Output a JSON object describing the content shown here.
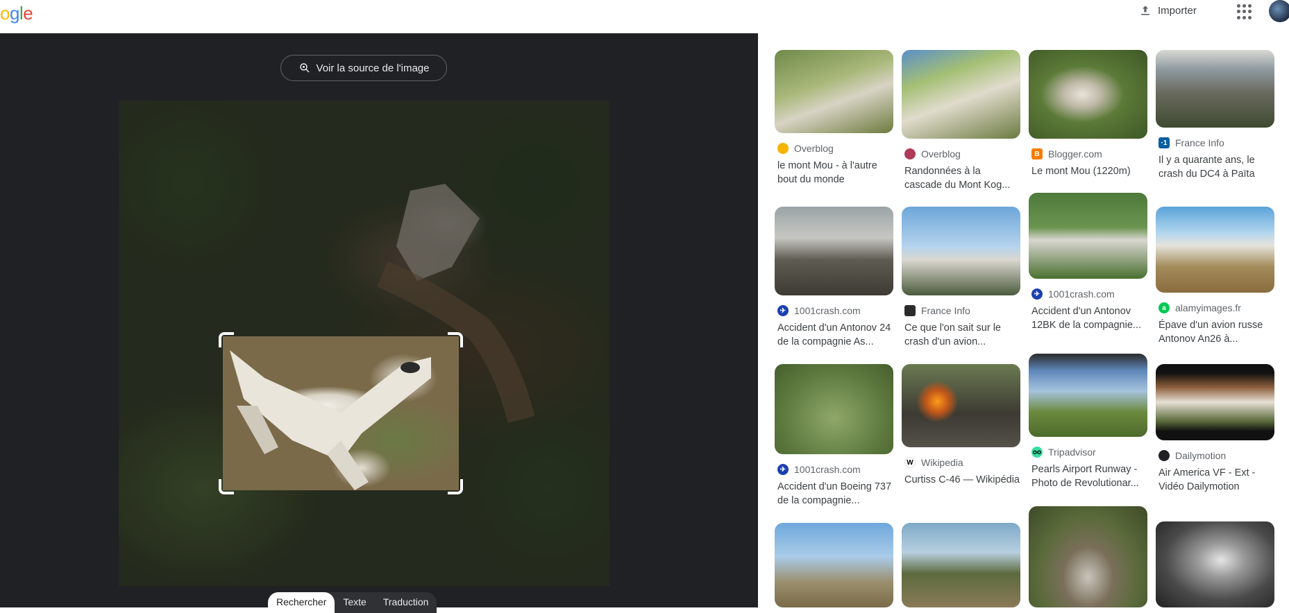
{
  "header": {
    "logo_text": "ogle",
    "import_label": "Importer",
    "icons": {
      "import": "upload-icon",
      "apps": "apps-grid-icon",
      "avatar": "user-avatar"
    }
  },
  "viewer": {
    "source_button_label": "Voir la source de l'image",
    "tabs": [
      {
        "label": "Rechercher",
        "active": true
      },
      {
        "label": "Texte",
        "active": false
      },
      {
        "label": "Traduction",
        "active": false
      }
    ]
  },
  "results": [
    {
      "source": "Overblog",
      "icon_color": "#f4b400",
      "title": "le mont Mou - à l'autre bout du monde"
    },
    {
      "source": "Overblog",
      "icon_color": "#b03b58",
      "title": "Randonnées à la cascade du Mont Kog..."
    },
    {
      "source": "Blogger.com",
      "icon_color": "#f57d00",
      "title": "Le mont Mou (1220m)"
    },
    {
      "source": "France Info",
      "icon_color": "#0a5d9e",
      "title": "Il y a quarante ans, le crash du DC4 à Païta"
    },
    {
      "source": "1001crash.com",
      "icon_color": "#1a3fb0",
      "title": "Accident d'un Antonov 24 de la compagnie As..."
    },
    {
      "source": "France Info",
      "icon_color": "#2b2b2b",
      "title": "Ce que l'on sait sur le crash d'un avion..."
    },
    {
      "source": "1001crash.com",
      "icon_color": "#1a3fb0",
      "title": "Accident d'un Antonov 12BK de la compagnie..."
    },
    {
      "source": "alamyimages.fr",
      "icon_color": "#00c853",
      "title": "Épave d'un avion russe Antonov An26 à..."
    },
    {
      "source": "1001crash.com",
      "icon_color": "#1a3fb0",
      "title": "Accident d'un Boeing 737 de la compagnie..."
    },
    {
      "source": "Wikipedia",
      "icon_color": "#ffffff",
      "title": "Curtiss C-46 — Wikipédia"
    },
    {
      "source": "Tripadvisor",
      "icon_color": "#34e0a1",
      "title": "Pearls Airport Runway - Photo de Revolutionar..."
    },
    {
      "source": "Dailymotion",
      "icon_color": "#202124",
      "title": "Air America VF - Ext - Vidéo Dailymotion"
    }
  ]
}
